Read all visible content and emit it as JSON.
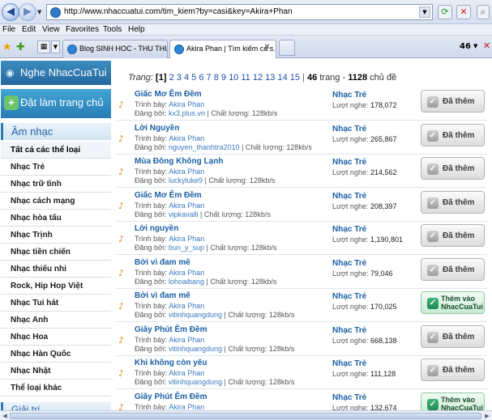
{
  "browser": {
    "url": "http://www.nhaccuatui.com/tim_kiem?by=casi&key=Akira+Phan",
    "menu": [
      "File",
      "Edit",
      "View",
      "Favorites",
      "Tools",
      "Help"
    ],
    "tabs": [
      {
        "title": "Blog SINH HOC - THU THUAT..."
      },
      {
        "title": "Akira Phan | Tìm kiếm ca s..."
      }
    ],
    "tab_count": "46"
  },
  "sidebar": {
    "header1": "Nghe NhacCuaTui",
    "header2": "Đặt làm trang chủ",
    "category": "Âm nhạc",
    "items": [
      "Tất cả các thể loại",
      "Nhạc Trẻ",
      "Nhạc trữ tình",
      "Nhạc cách mạng",
      "Nhạc hòa tấu",
      "Nhạc Trịnh",
      "Nhạc tiền chiến",
      "Nhạc thiếu nhi",
      "Rock, Hip Hop Việt",
      "Nhạc Tui hát",
      "Nhạc Anh",
      "Nhạc Hoa",
      "Nhạc Hàn Quốc",
      "Nhạc Nhật",
      "Thể loại khác"
    ],
    "category2": "Giải trí"
  },
  "pager": {
    "label": "Trang:",
    "current": "[1]",
    "pages": [
      "2",
      "3",
      "4",
      "5",
      "6",
      "7",
      "8",
      "9",
      "10",
      "11",
      "12",
      "13",
      "14",
      "15"
    ],
    "sep": "|",
    "total_pages": "46",
    "pages_word": "trang",
    "dash": "-",
    "total_topics": "1128",
    "topics_word": "chủ đề"
  },
  "labels": {
    "singer_prefix": "Trình bày:",
    "uploader_prefix": "Đăng bởi:",
    "quality_prefix": "| Chất lượng:",
    "plays_prefix": "Lượt nghe:"
  },
  "songs": [
    {
      "title": "Giấc Mơ Êm Đềm",
      "singer": "Akira Phan",
      "uploader": "kx3.plus.vn",
      "quality": "128kb/s",
      "category": "Nhạc Trẻ",
      "plays": "178,072",
      "button": "Đã thêm",
      "button_style": "gray"
    },
    {
      "title": "Lời Nguyền",
      "singer": "Akira Phan",
      "uploader": "nguyen_thanhtra2010",
      "quality": "128kb/s",
      "category": "Nhạc Trẻ",
      "plays": "265,867",
      "button": "Đã thêm",
      "button_style": "gray"
    },
    {
      "title": "Mùa Đông Không Lạnh",
      "singer": "Akira Phan",
      "uploader": "luckyluke9",
      "quality": "128kb/s",
      "category": "Nhạc Trẻ",
      "plays": "214,562",
      "button": "Đã thêm",
      "button_style": "gray"
    },
    {
      "title": "Giấc Mơ Êm Đềm",
      "singer": "Akira Phan",
      "uploader": "vipkavalli",
      "quality": "128kb/s",
      "category": "Nhạc Trẻ",
      "plays": "208,397",
      "button": "Đã thêm",
      "button_style": "gray"
    },
    {
      "title": "Lời nguyền",
      "singer": "Akira Phan",
      "uploader": "bun_y_sup",
      "quality": "128kb/s",
      "category": "Nhạc Trẻ",
      "plays": "1,190,801",
      "button": "Đã thêm",
      "button_style": "gray"
    },
    {
      "title": "Bởi vì đam mê",
      "singer": "Akira Phan",
      "uploader": "lohoaibang",
      "quality": "128kb/s",
      "category": "Nhạc Trẻ",
      "plays": "79,046",
      "button": "Đã thêm",
      "button_style": "gray"
    },
    {
      "title": "Bởi vì đam mê",
      "singer": "Akira Phan",
      "uploader": "vitinhquangdung",
      "quality": "128kb/s",
      "category": "Nhạc Trẻ",
      "plays": "170,025",
      "button": "Thêm vào NhacCuaTui",
      "button_style": "green"
    },
    {
      "title": "Giây Phút Êm Đềm",
      "singer": "Akira Phan",
      "uploader": "vitinhquangdung",
      "quality": "128kb/s",
      "category": "Nhạc Trẻ",
      "plays": "668,138",
      "button": "Đã thêm",
      "button_style": "gray"
    },
    {
      "title": "Khi không còn yêu",
      "singer": "Akira Phan",
      "uploader": "vitinhquangdung",
      "quality": "128kb/s",
      "category": "Nhạc Trẻ",
      "plays": "111,128",
      "button": "Đã thêm",
      "button_style": "gray"
    },
    {
      "title": "Giây Phút Êm Đềm",
      "singer": "Akira Phan",
      "uploader": "vitinhquangdung",
      "quality": "128kb/s",
      "category": "Nhạc Trẻ",
      "plays": "132,674",
      "button": "Thêm vào NhacCuaTui",
      "button_style": "green"
    }
  ]
}
